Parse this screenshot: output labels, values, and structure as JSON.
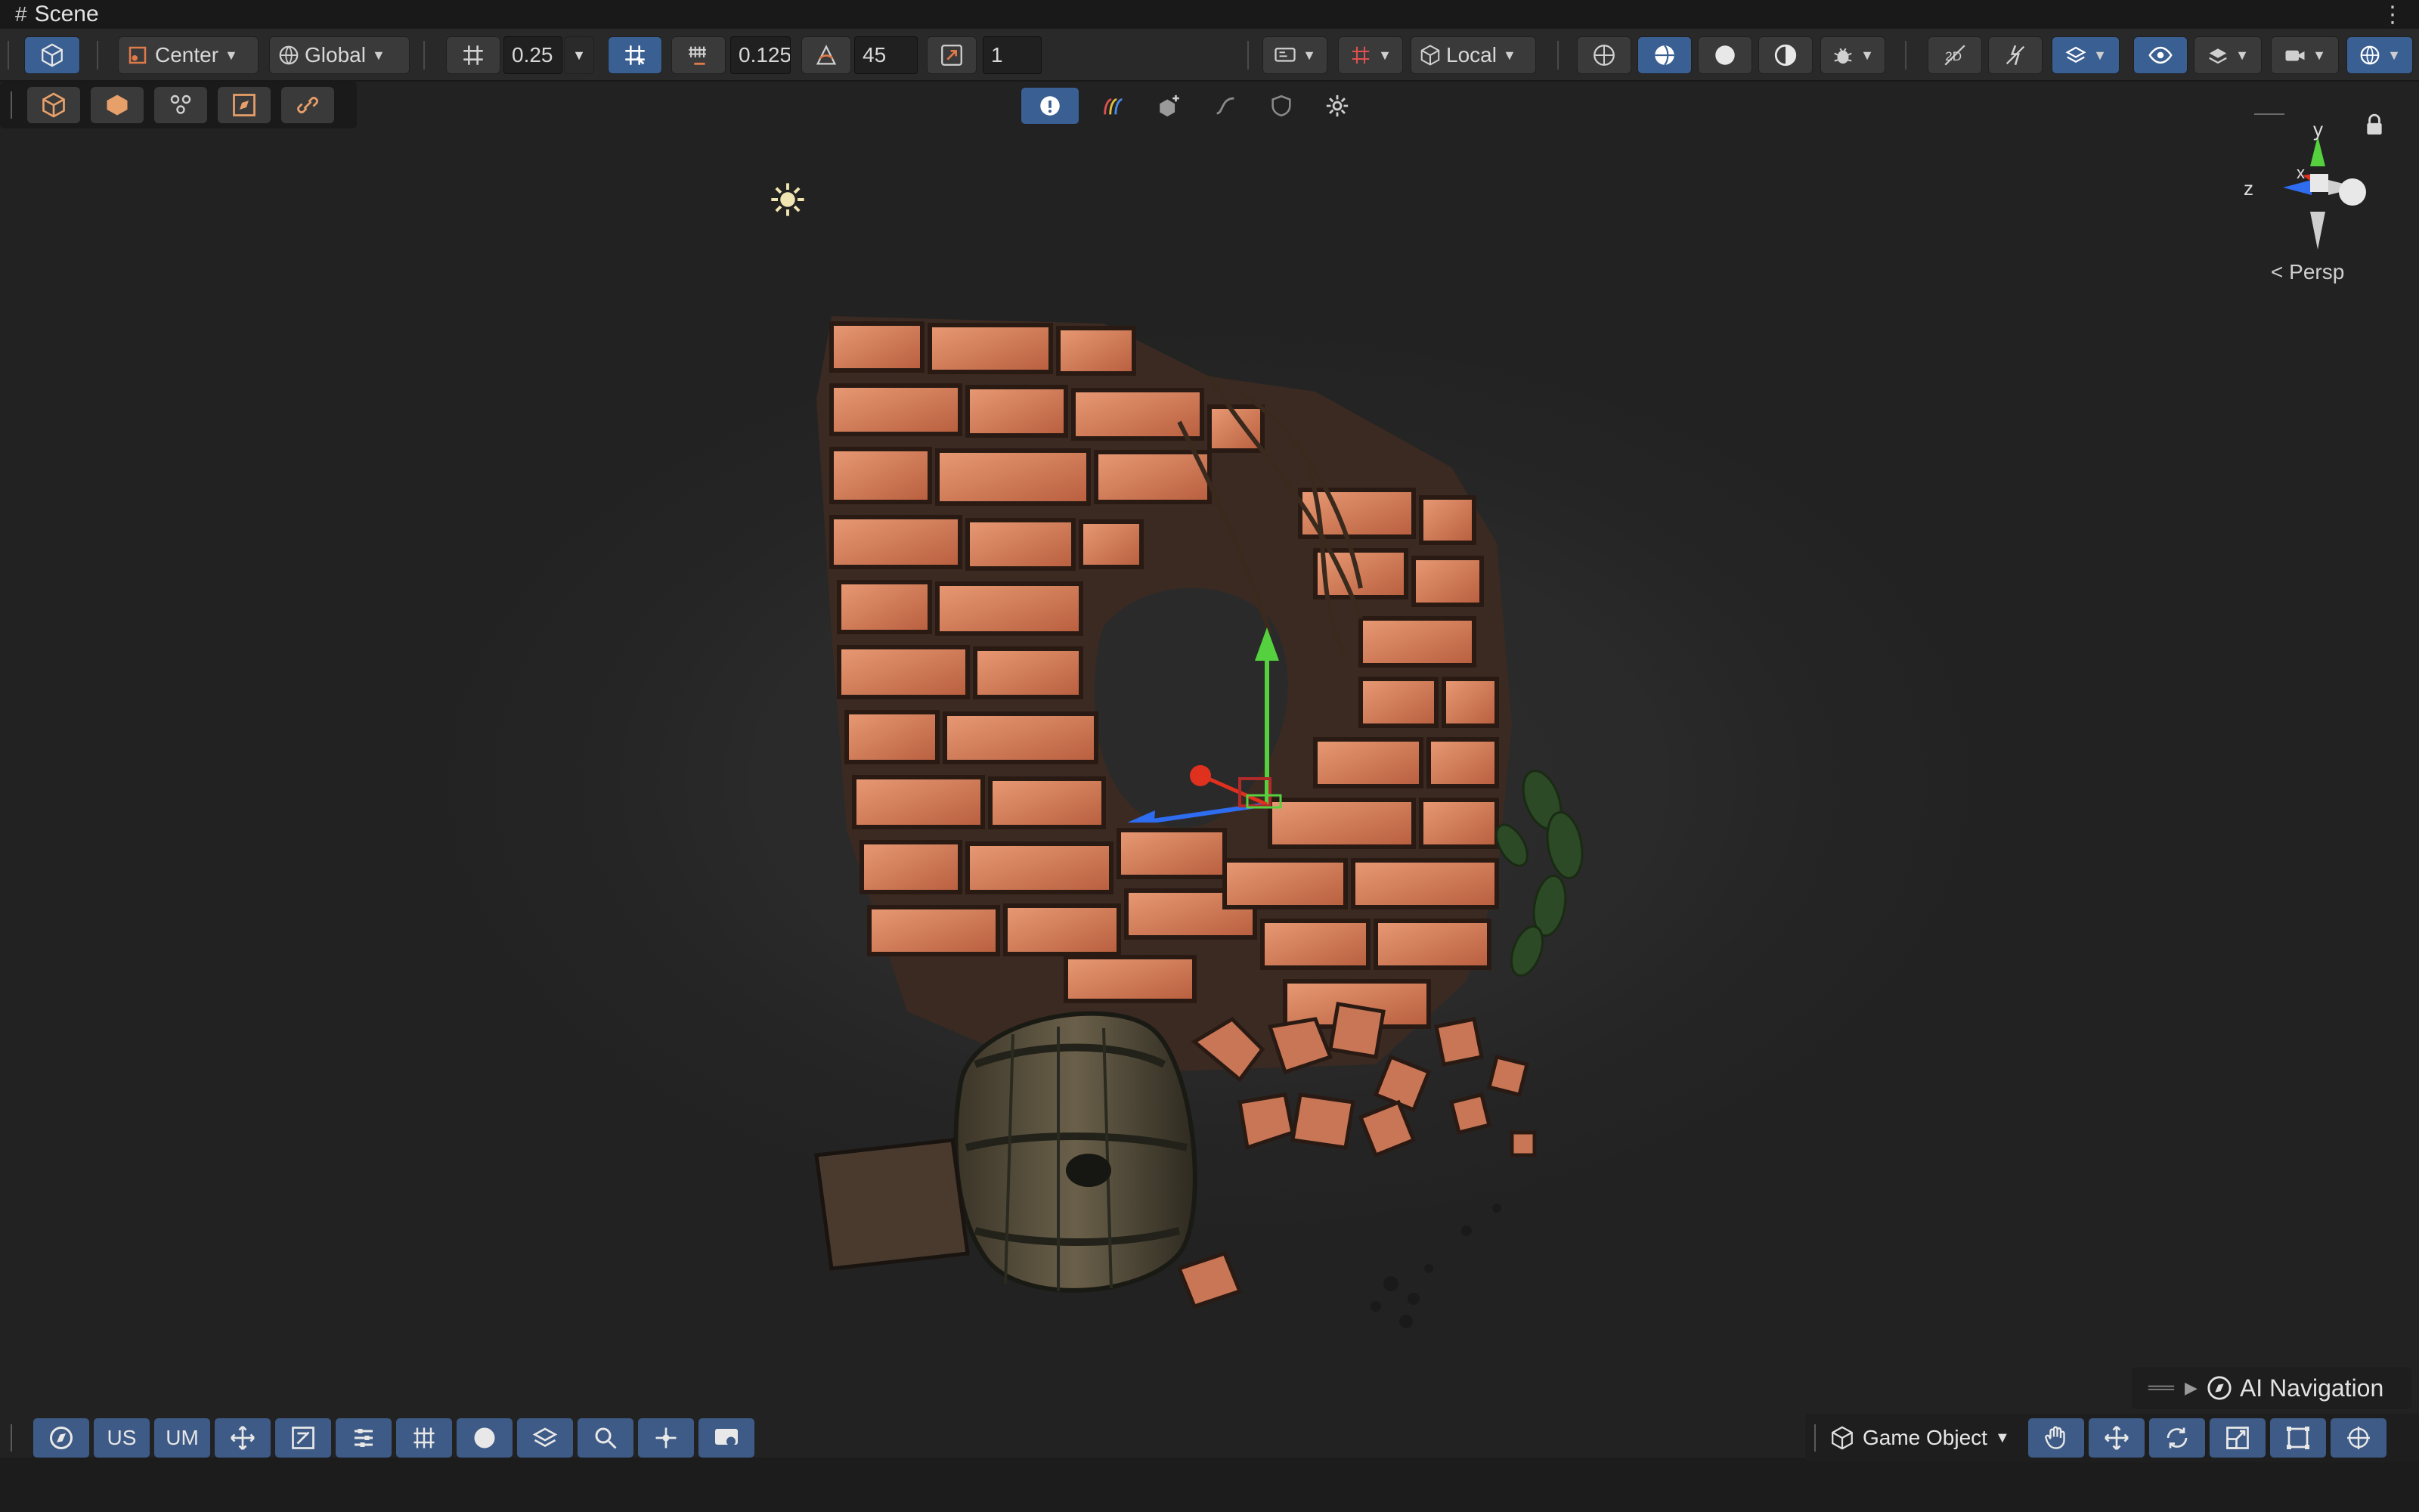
{
  "window": {
    "title": "Scene"
  },
  "toolbar": {
    "pivot_label": "Center",
    "space_label": "Global",
    "grid_snap_value": "0.25",
    "increment_snap_value": "0.125",
    "rotation_snap_value": "45",
    "scale_snap_value": "1",
    "handle_space_label": "Local"
  },
  "viewport": {
    "orientation_gizmo": {
      "axis_y": "y",
      "axis_x": "x",
      "axis_z": "z",
      "projection_label": "Persp"
    },
    "ai_navigation_label": "AI Navigation",
    "objects": [
      "broken-brick-wall",
      "wooden-barrel",
      "fern-plant",
      "directional-light"
    ]
  },
  "bottombar": {
    "us_label": "US",
    "um_label": "UM",
    "tool_context_label": "Game Object"
  },
  "colors": {
    "accent_blue": "#3a5f92",
    "axis_x": "#e0301e",
    "axis_y": "#55d13f",
    "axis_z": "#2e6cf0",
    "brick": "#c9704a"
  }
}
